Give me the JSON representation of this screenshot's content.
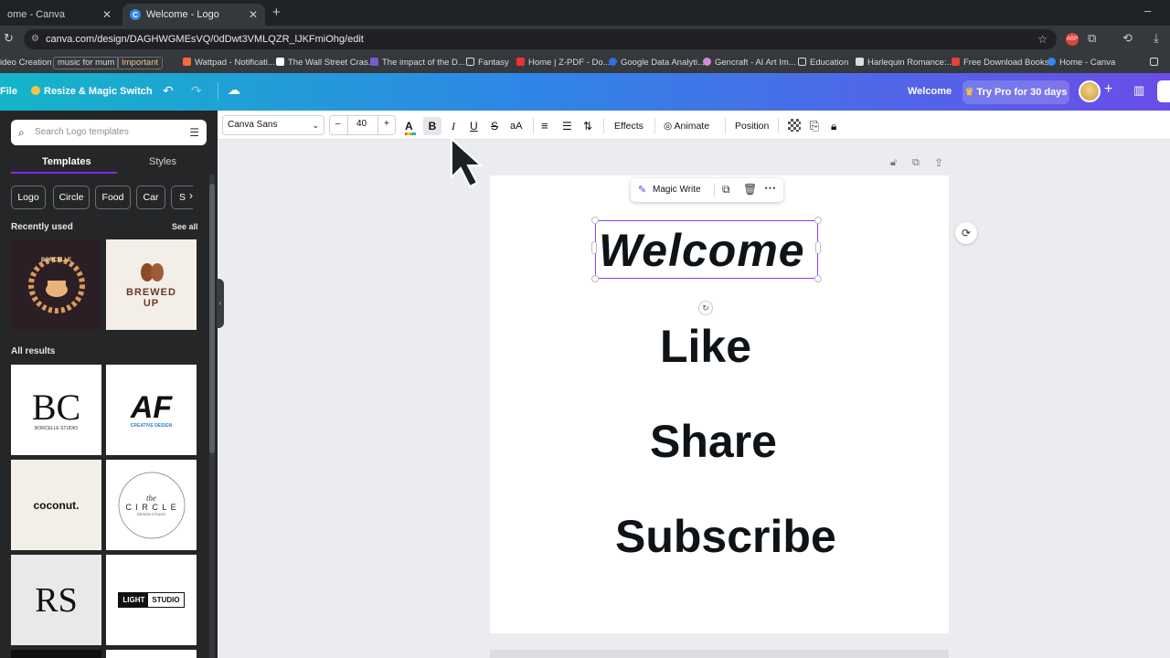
{
  "browser": {
    "tabs": [
      {
        "label": "ome - Canva",
        "active": false
      },
      {
        "label": "Welcome - Logo",
        "active": true
      }
    ],
    "new_tab": "+",
    "minimize": "–",
    "url": "canva.com/design/DAGHWGMEsVQ/0dDwt3VMLQZR_lJKFmiOhg/edit",
    "bookmarks": [
      {
        "label": "ideo Creation",
        "boxed": false
      },
      {
        "label": "music for mum",
        "boxed": true
      },
      {
        "label": "Important",
        "boxed": true
      },
      {
        "label": "Wattpad - Notificati...",
        "boxed": false
      },
      {
        "label": "The Wall Street Cras...",
        "boxed": false
      },
      {
        "label": "The impact of the D...",
        "boxed": false
      },
      {
        "label": "Fantasy",
        "boxed": false
      },
      {
        "label": "Home | Z-PDF - Do...",
        "boxed": false
      },
      {
        "label": "Google Data Analyti...",
        "boxed": false
      },
      {
        "label": "Gencraft - AI Art Im...",
        "boxed": false
      },
      {
        "label": "Education",
        "boxed": false
      },
      {
        "label": "Harlequin Romance:...",
        "boxed": false
      },
      {
        "label": "Free Download Books",
        "boxed": false
      },
      {
        "label": "Home - Canva",
        "boxed": false
      }
    ]
  },
  "header": {
    "file_label": "File",
    "resize_label": "Resize & Magic Switch",
    "doc_title": "Welcome",
    "try_pro": "Try Pro for 30 days",
    "add": "+"
  },
  "sidebar": {
    "search_placeholder": "Search Logo templates",
    "tabs": [
      "Templates",
      "Styles"
    ],
    "chips": [
      "Logo",
      "Circle",
      "Food",
      "Car",
      "S"
    ],
    "recently_used": "Recently used",
    "see_all": "See all",
    "all_results": "All results",
    "thumbs": {
      "borcelle": "BORCELLE",
      "brewed": "BREWED",
      "up": "UP",
      "borcelle_studio": "BORCELLE STUDIO",
      "af": "AF",
      "creative_design": "CREATIVE DESIGN",
      "coconut": "coconut.",
      "circle_the": "the",
      "circle": "C I R C L E",
      "circle_sub": "DESIGN STUDIO",
      "rs": "RS",
      "light": "LIGHT",
      "studio": "STUDIO"
    }
  },
  "toolbar": {
    "font": "Canva Sans",
    "size": "40",
    "minus": "–",
    "plus": "+",
    "bold": "B",
    "italic": "I",
    "underline": "U",
    "strike": "S",
    "case": "aA",
    "effects": "Effects",
    "animate": "Animate",
    "position": "Position"
  },
  "canvas": {
    "texts": [
      "Welcome",
      "Like",
      "Share",
      "Subscribe"
    ],
    "magic_write": "Magic Write"
  },
  "colors": {
    "accent": "#8b3dff",
    "header_start": "#14b5c8",
    "header_end": "#6a4de8",
    "sidebar_bg": "#252627"
  }
}
